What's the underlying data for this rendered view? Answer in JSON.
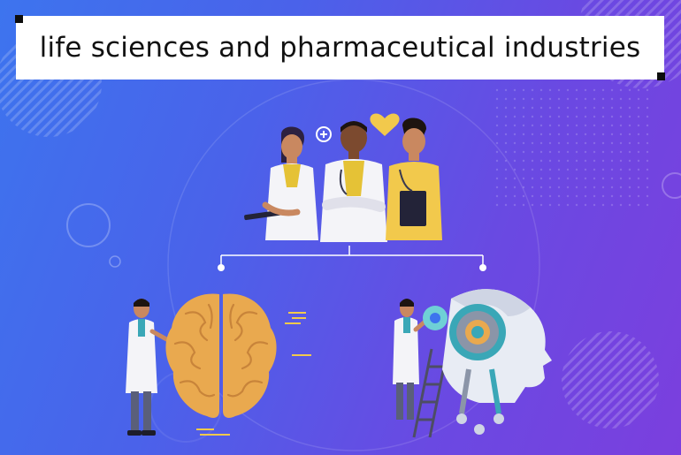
{
  "banner": {
    "title": "life sciences and pharmaceutical industries"
  },
  "illustration": {
    "top_group": [
      "female-doctor",
      "male-doctor",
      "male-nurse"
    ],
    "left_branch": [
      "scientist",
      "human-brain"
    ],
    "right_branch": [
      "scientist-on-ladder",
      "robot-head"
    ]
  },
  "colors": {
    "background_start": "#3d74ee",
    "background_end": "#7b3fde",
    "accent_yellow": "#f2c94c",
    "brain": "#e9a94f",
    "robot_teal": "#3aa7b7"
  },
  "icons": [
    "heart-icon",
    "medical-plus-icon"
  ]
}
